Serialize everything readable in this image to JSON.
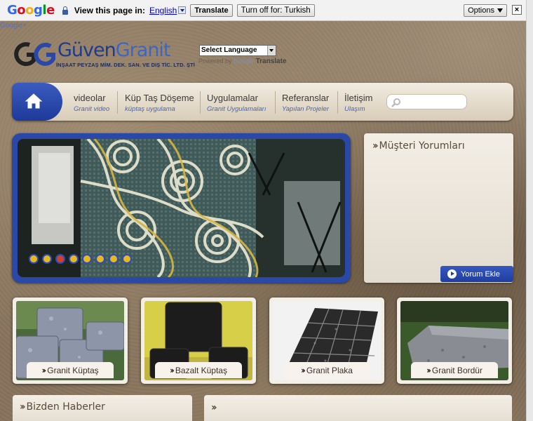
{
  "translate_bar": {
    "google": [
      "G",
      "o",
      "o",
      "g",
      "l",
      "e"
    ],
    "prompt": "View this page in:",
    "language": "English",
    "translate_btn": "Translate",
    "turn_off_btn": "Turn off for: Turkish",
    "options_btn": "Options",
    "close": "×",
    "small_link": "Google+"
  },
  "header": {
    "logo_name_a": "Güven",
    "logo_name_b": "Granit",
    "logo_sub": "İNŞAAT PEYZAŞ MİM. DEK. SAN. VE DIŞ TİC. LTD. ŞTİ",
    "language_select": "Select Language",
    "powered_prefix": "Powered by",
    "powered_brand": "Google",
    "powered_suffix": "Translate"
  },
  "nav": {
    "items": [
      {
        "title": "videolar",
        "sub": "Granit video"
      },
      {
        "title": "Küp Taş Döşeme",
        "sub": "küptaş uygulama"
      },
      {
        "title": "Uygulamalar",
        "sub": "Granit Uygulamaları"
      },
      {
        "title": "Referanslar",
        "sub": "Yapılan Projeler"
      },
      {
        "title": "İletişim",
        "sub": "Ulaşım"
      }
    ],
    "search_placeholder": ""
  },
  "slider": {
    "dot_count": 8,
    "active_dot": 3
  },
  "reviews": {
    "title": "Müşteri Yorumları",
    "button": "Yorum Ekle"
  },
  "products": [
    {
      "label": "Granit Küptaş"
    },
    {
      "label": "Bazalt Küptaş"
    },
    {
      "label": "Granit Plaka"
    },
    {
      "label": "Granit Bordür"
    }
  ],
  "news": {
    "title": "Bizden Haberler"
  },
  "colors": {
    "brand_blue": "#2a48a8",
    "link_blue": "#4466bb",
    "panel": "#f3eee5"
  }
}
